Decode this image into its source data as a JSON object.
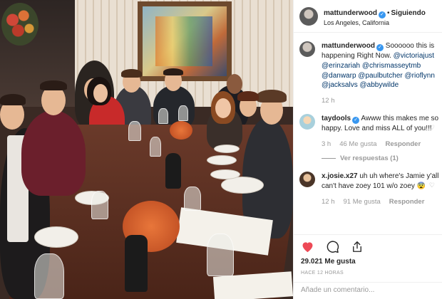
{
  "post": {
    "username": "mattunderwood",
    "follow_separator": "•",
    "follow_label": "Siguiendo",
    "location": "Los Angeles, California"
  },
  "caption": {
    "username": "mattunderwood",
    "text": "Soooooo this is happening Right Now.",
    "mentions": [
      "@victoriajust",
      "@erinzariah",
      "@chrismasseytmb",
      "@danwarp",
      "@paulbutcher",
      "@rioflynn",
      "@jacksalvs",
      "@abbywilde"
    ],
    "time": "12 h"
  },
  "comments": [
    {
      "username": "taydools",
      "text": "Awww this makes me so happy. Love and miss ALL of you!!!",
      "time": "3 h",
      "likes": "46 Me gusta",
      "reply_label": "Responder",
      "view_replies": "Ver respuestas (1)"
    },
    {
      "username": "x.josie.x27",
      "text": "uh uh where's Jamie y'all can't have zoey 101 w/o zoey 😨",
      "time": "12 h",
      "likes": "91 Me gusta",
      "reply_label": "Responder"
    }
  ],
  "engagement": {
    "likes": "29.021 Me gusta",
    "time_ago": "HACE 12 HORAS"
  },
  "add_comment": {
    "placeholder": "Añade un comentario..."
  },
  "icons": {
    "verified": "verified-badge",
    "like": "heart-icon",
    "comment": "comment-icon",
    "share": "share-icon"
  },
  "colors": {
    "like": "#ed4956",
    "verified": "#3897f0",
    "mention": "#003569",
    "muted": "#999999"
  }
}
